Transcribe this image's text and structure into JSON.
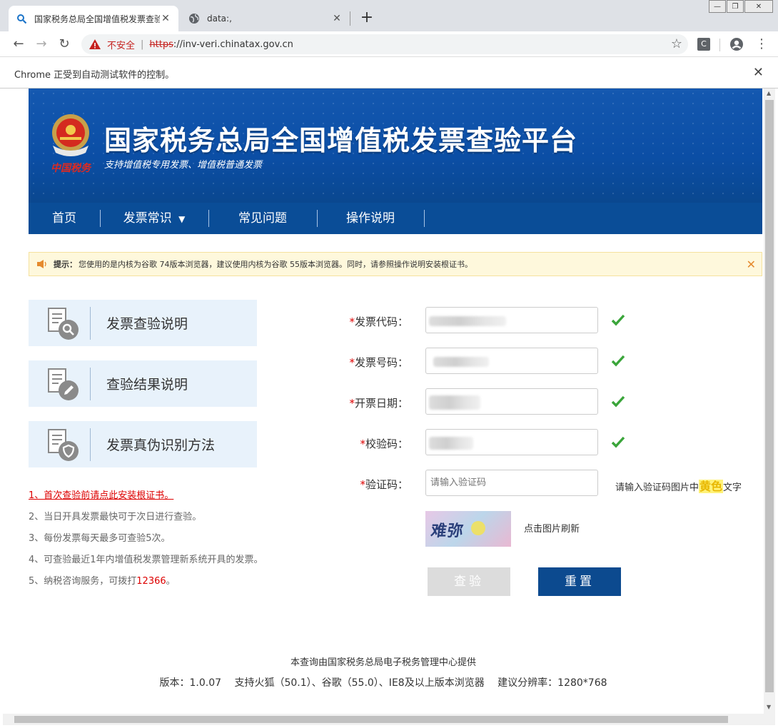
{
  "browser": {
    "tabs": [
      {
        "title": "国家税务总局全国增值税发票查验",
        "icon": "magnifier-globe-icon"
      },
      {
        "title": "data:,",
        "icon": "globe-icon"
      }
    ],
    "security_label": "不安全",
    "url_protocol": "https",
    "url_rest": "://inv-veri.chinatax.gov.cn",
    "extension_letter": "C",
    "infobar_text": "Chrome 正受到自动测试软件的控制。"
  },
  "header": {
    "title": "国家税务总局全国增值税发票查验平台",
    "subtitle": "支持增值税专用发票、增值税普通发票",
    "emblem_caption": "中国税务"
  },
  "nav": {
    "items": [
      "首页",
      "发票常识",
      "常见问题",
      "操作说明"
    ]
  },
  "notice": {
    "label": "提示：",
    "text": "您使用的是内核为谷歌 74版本浏览器，建议使用内核为谷歌 55版本浏览器。同时，请参照操作说明安装根证书。"
  },
  "cards": [
    {
      "label": "发票查验说明",
      "icon": "document-search-icon"
    },
    {
      "label": "查验结果说明",
      "icon": "document-edit-icon"
    },
    {
      "label": "发票真伪识别方法",
      "icon": "document-shield-icon"
    }
  ],
  "tips": {
    "t1": "1、首次查验前请点此安装根证书。",
    "t2": "2、当日开具发票最快可于次日进行查验。",
    "t3": "3、每份发票每天最多可查验5次。",
    "t4": "4、可查验最近1年内增值税发票管理新系统开具的发票。",
    "t5_prefix": "5、纳税咨询服务，可拨打",
    "t5_phone": "12366",
    "t5_suffix": "。"
  },
  "form": {
    "invoice_code_label": "发票代码：",
    "invoice_number_label": "发票号码：",
    "invoice_date_label": "开票日期：",
    "check_code_label": "校验码：",
    "captcha_label": "验证码：",
    "required_mark": "*",
    "captcha_placeholder": "请输入验证码",
    "captcha_hint_prefix": "请输入验证码图片中",
    "captcha_hint_color": "黄色",
    "captcha_hint_suffix": "文字",
    "refresh_text": "点击图片刷新",
    "captcha_image_text": "难弥 ",
    "check_button": "查验",
    "reset_button": "重置"
  },
  "footer": {
    "provider": "本查询由国家税务总局电子税务管理中心提供",
    "version": "版本：1.0.07",
    "browsers": "支持火狐（50.1）、谷歌（55.0）、IE8及以上版本浏览器",
    "resolution": "建议分辨率：1280*768"
  },
  "colors": {
    "banner_blue": "#0b4ea5",
    "nav_blue": "#0a4d97",
    "required_red": "#dd0000",
    "check_green": "#3aa53a",
    "reset_button_blue": "#0c4a8f"
  }
}
